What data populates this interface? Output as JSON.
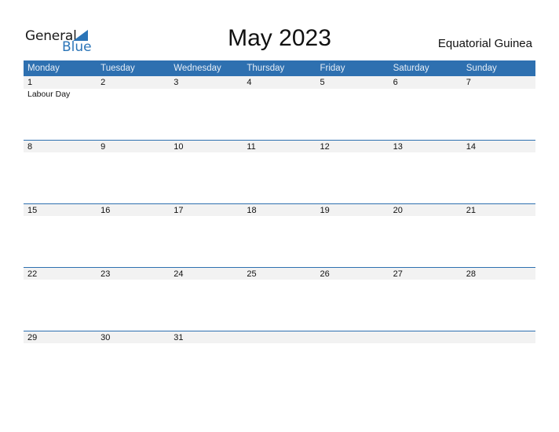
{
  "logo": {
    "line1": "General",
    "line2": "Blue"
  },
  "title": "May 2023",
  "country": "Equatorial Guinea",
  "colors": {
    "accent": "#2e70b0",
    "strip": "#f2f2f2"
  },
  "weekdays": [
    "Monday",
    "Tuesday",
    "Wednesday",
    "Thursday",
    "Friday",
    "Saturday",
    "Sunday"
  ],
  "weeks": [
    {
      "days": [
        "1",
        "2",
        "3",
        "4",
        "5",
        "6",
        "7"
      ],
      "events": [
        "Labour Day",
        "",
        "",
        "",
        "",
        "",
        ""
      ]
    },
    {
      "days": [
        "8",
        "9",
        "10",
        "11",
        "12",
        "13",
        "14"
      ],
      "events": [
        "",
        "",
        "",
        "",
        "",
        "",
        ""
      ]
    },
    {
      "days": [
        "15",
        "16",
        "17",
        "18",
        "19",
        "20",
        "21"
      ],
      "events": [
        "",
        "",
        "",
        "",
        "",
        "",
        ""
      ]
    },
    {
      "days": [
        "22",
        "23",
        "24",
        "25",
        "26",
        "27",
        "28"
      ],
      "events": [
        "",
        "",
        "",
        "",
        "",
        "",
        ""
      ]
    },
    {
      "days": [
        "29",
        "30",
        "31",
        "",
        "",
        "",
        ""
      ],
      "events": [
        "",
        "",
        "",
        "",
        "",
        "",
        ""
      ]
    }
  ]
}
